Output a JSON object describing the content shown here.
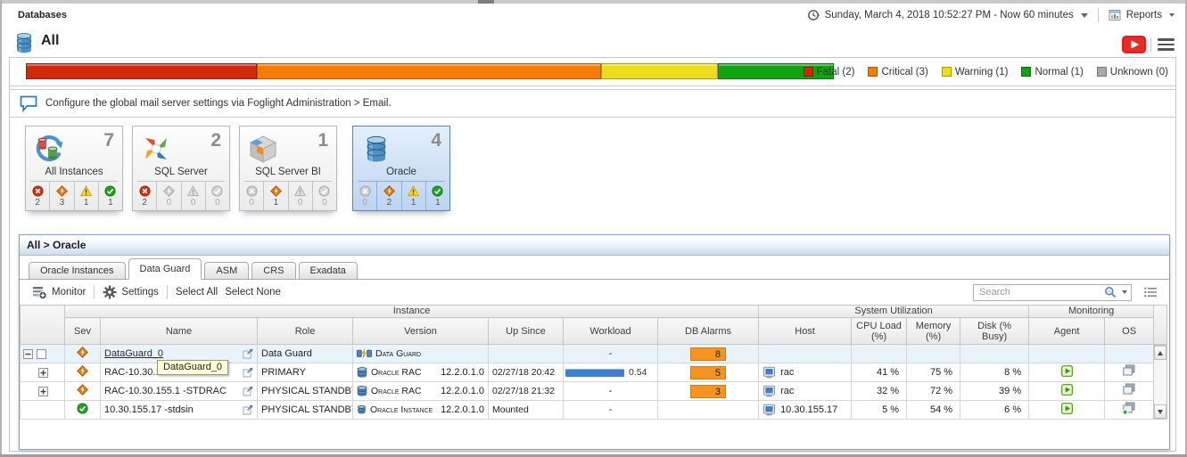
{
  "window": {
    "breadcrumb": "Databases",
    "page_title": "All",
    "time_range": "Sunday, March 4, 2018 10:52:27 PM - Now 60 minutes",
    "reports_label": "Reports"
  },
  "alarm_summary": {
    "total": 7,
    "legend": [
      {
        "name": "Fatal",
        "count": 2,
        "display": "Fatal (2)",
        "color": "#cf2a0e"
      },
      {
        "name": "Critical",
        "count": 3,
        "display": "Critical (3)",
        "color": "#f57d07"
      },
      {
        "name": "Warning",
        "count": 1,
        "display": "Warning (1)",
        "color": "#eedd1c"
      },
      {
        "name": "Normal",
        "count": 1,
        "display": "Normal (1)",
        "color": "#12a312"
      },
      {
        "name": "Unknown",
        "count": 0,
        "display": "Unknown (0)",
        "color": "#a9a9a9"
      }
    ]
  },
  "message": {
    "text": "Configure the global mail server settings via Foglight Administration > Email."
  },
  "tiles": [
    {
      "name": "All Instances",
      "count": 7,
      "icon": "all-instances",
      "selected": false,
      "statuses": [
        {
          "type": "fatal",
          "count": 2,
          "active": true
        },
        {
          "type": "critical",
          "count": 3,
          "active": true
        },
        {
          "type": "warning",
          "count": 1,
          "active": true
        },
        {
          "type": "normal",
          "count": 1,
          "active": true
        }
      ]
    },
    {
      "name": "SQL Server",
      "count": 2,
      "icon": "sql-server",
      "selected": false,
      "statuses": [
        {
          "type": "fatal",
          "count": 2,
          "active": true
        },
        {
          "type": "critical",
          "count": 0,
          "active": false
        },
        {
          "type": "warning",
          "count": 0,
          "active": false
        },
        {
          "type": "normal",
          "count": 0,
          "active": false
        }
      ]
    },
    {
      "name": "SQL Server BI",
      "count": 1,
      "icon": "sql-server-bi",
      "selected": false,
      "statuses": [
        {
          "type": "fatal",
          "count": 0,
          "active": false
        },
        {
          "type": "critical",
          "count": 1,
          "active": true
        },
        {
          "type": "warning",
          "count": 0,
          "active": false
        },
        {
          "type": "normal",
          "count": 0,
          "active": false
        }
      ]
    },
    {
      "name": "Oracle",
      "count": 4,
      "icon": "oracle",
      "selected": true,
      "statuses": [
        {
          "type": "fatal",
          "count": 0,
          "active": false
        },
        {
          "type": "critical",
          "count": 2,
          "active": true
        },
        {
          "type": "warning",
          "count": 1,
          "active": true
        },
        {
          "type": "normal",
          "count": 1,
          "active": true
        }
      ]
    }
  ],
  "panel": {
    "breadcrumb": "All > Oracle",
    "tabs": [
      {
        "label": "Oracle Instances",
        "active": false
      },
      {
        "label": "Data Guard",
        "active": true
      },
      {
        "label": "ASM",
        "active": false
      },
      {
        "label": "CRS",
        "active": false
      },
      {
        "label": "Exadata",
        "active": false
      }
    ],
    "toolbar": {
      "monitor": "Monitor",
      "settings": "Settings",
      "select_all": "Select All",
      "select_none": "Select None",
      "search_placeholder": "Search"
    },
    "table": {
      "groups": [
        {
          "label": "Instance",
          "span": 7
        },
        {
          "label": "System Utilization",
          "span": 4
        },
        {
          "label": "Monitoring",
          "span": 2
        }
      ],
      "columns": [
        "Sev",
        "Name",
        "Role",
        "Version",
        "Up Since",
        "Workload",
        "DB Alarms",
        "Host",
        "CPU Load (%)",
        "Memory (%)",
        "Disk (% Busy)",
        "Agent",
        "OS"
      ],
      "rows": [
        {
          "selected": true,
          "expander": "collapse",
          "checkbox": true,
          "severity": "critical",
          "name": "DataGuard_0",
          "name_is_link": true,
          "role": "Data Guard",
          "product": "Data Guard",
          "product_icon": "data-guard",
          "version": "",
          "up_since": "",
          "workload": "-",
          "workload_label": null,
          "db_alarms": 8,
          "host": "",
          "cpu": "",
          "memory": "",
          "disk": "",
          "agent": false,
          "os": null
        },
        {
          "selected": false,
          "expander": "expand",
          "checkbox": false,
          "severity": "critical",
          "name": "RAC-10.30.1",
          "name_is_link": false,
          "role": "PRIMARY",
          "product": "Oracle RAC",
          "product_icon": "oracle-rac",
          "version": "12.2.0.1.0",
          "up_since": "02/27/18 20:42",
          "workload": 0.54,
          "workload_label": "0.54",
          "db_alarms": 5,
          "host": "rac",
          "cpu": "41 %",
          "memory": "75 %",
          "disk": "8 %",
          "agent": true,
          "os": "agent"
        },
        {
          "selected": false,
          "expander": "expand",
          "checkbox": false,
          "severity": "critical",
          "name": "RAC-10.30.155.1 -STDRAC",
          "name_is_link": false,
          "role": "PHYSICAL STANDBY",
          "product": "Oracle RAC",
          "product_icon": "oracle-rac",
          "version": "12.2.0.1.0",
          "up_since": "02/27/18 21:32",
          "workload": "-",
          "workload_label": null,
          "db_alarms": 3,
          "host": "rac",
          "cpu": "32 %",
          "memory": "72 %",
          "disk": "39 %",
          "agent": true,
          "os": "agent"
        },
        {
          "selected": false,
          "expander": null,
          "checkbox": false,
          "severity": "normal",
          "name": "10.30.155.17 -stdsin",
          "name_is_link": false,
          "role": "PHYSICAL STANDBY",
          "product": "Oracle Instance",
          "product_icon": "oracle-instance",
          "version": "12.2.0.1.0",
          "up_since": "Mounted",
          "workload": "-",
          "workload_label": null,
          "db_alarms": null,
          "host": "10.30.155.17",
          "cpu": "5 %",
          "memory": "54 %",
          "disk": "6 %",
          "agent": true,
          "os": "agent-active"
        }
      ]
    },
    "tooltip": "DataGuard_0"
  },
  "colors": {
    "fatal": "#cf2a0e",
    "critical": "#f57d07",
    "warning": "#eedd1c",
    "normal": "#12a312",
    "unknown": "#a9a9a9",
    "alarm_badge": "#f79321",
    "workload_bar": "#3f7fd0",
    "selected_row": "#e9f3fc",
    "selected_tile_border": "#5b87b8"
  },
  "icons": {
    "timeline-icon": "clock-circle",
    "reports-icon": "report-page",
    "video-icon": "red-play-button",
    "menu-icon": "hamburger",
    "message-icon": "speech-bubble",
    "monitor-icon": "list-plus",
    "settings-icon": "gear",
    "search-icon": "magnifier",
    "customize-icon": "list-dots",
    "external-link-icon": "box-arrow",
    "host-icon": "computer",
    "agent-icon": "green-play",
    "os-icon": "stacked-windows"
  }
}
